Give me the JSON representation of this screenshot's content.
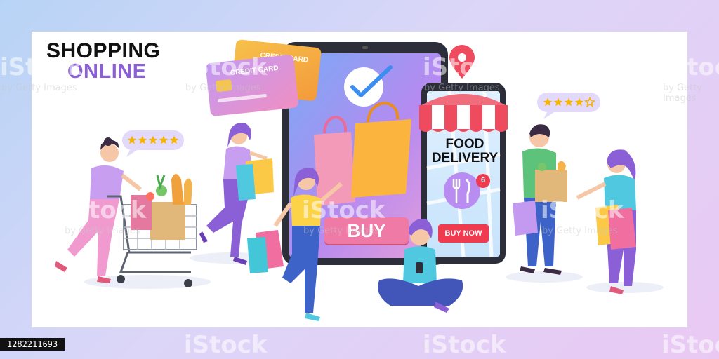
{
  "title": {
    "line1": "SHOPPING",
    "line2": "ONLINE"
  },
  "tablet": {
    "buy_label": "BUY"
  },
  "phone": {
    "headline_line1": "FOOD",
    "headline_line2": "DELIVERY",
    "badge_count": "6",
    "buy_now_label": "BUY NOW"
  },
  "cards": {
    "front_label": "CREDIT CARD",
    "back_label": "CREDIT CARD"
  },
  "ratings": {
    "cart_woman_stars": 5,
    "delivery_man_stars": 4,
    "max_stars": 5
  },
  "watermark": {
    "brand": "iStock",
    "sub": "by Getty Images",
    "image_id": "1282211693"
  },
  "colors": {
    "accent_purple": "#8b5fd6",
    "buy_pink": "#f07aa6",
    "buy_now_red": "#ee3b4f",
    "awning_red": "#ef4b5f"
  }
}
